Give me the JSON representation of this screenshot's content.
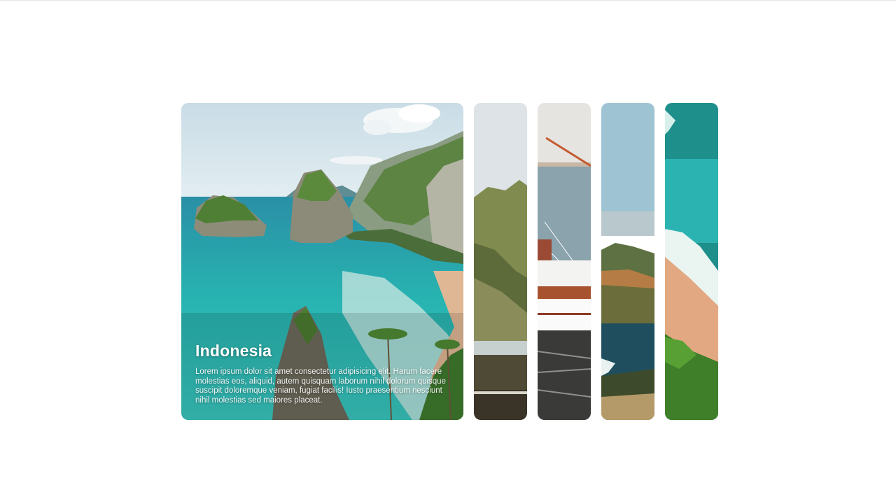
{
  "gallery": {
    "cards": [
      {
        "id": "indonesia",
        "active": true,
        "title": "Indonesia",
        "description": "Lorem ipsum dolor sit amet consectetur adipisicing elit. Harum facere molestias eos, aliquid, autem quisquam laborum nihil dolorum quisque suscipit doloremque veniam, fugiat facilis! Iusto praesentium nesciunt nihil molestias sed maiores placeat."
      },
      {
        "id": "mountain-coast",
        "active": false
      },
      {
        "id": "sailing-ship",
        "active": false
      },
      {
        "id": "island-bay",
        "active": false
      },
      {
        "id": "tropical-beach",
        "active": false
      }
    ]
  },
  "colors": {
    "sea": "#2bb3b1",
    "sky": "#cfe0ea",
    "sand": "#e2b38f",
    "vegetation": "#4a7a3a"
  }
}
